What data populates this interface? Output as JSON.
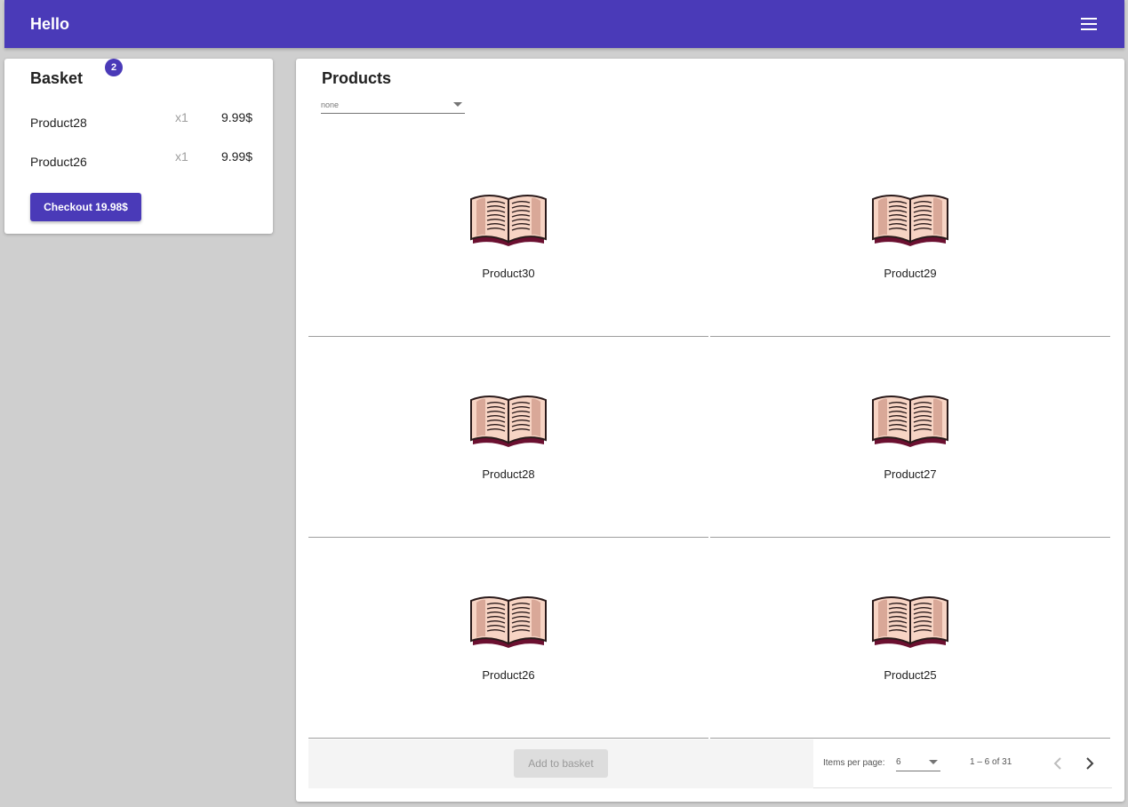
{
  "toolbar": {
    "title": "Hello",
    "menu_icon": "menu-icon"
  },
  "basket": {
    "title": "Basket",
    "badge_count": "2",
    "items": [
      {
        "name": "Product28",
        "qty": "x1",
        "price": "9.99$"
      },
      {
        "name": "Product26",
        "qty": "x1",
        "price": "9.99$"
      }
    ],
    "checkout_label": "Checkout 19.98$"
  },
  "products": {
    "title": "Products",
    "filter": {
      "value": "none"
    },
    "items": [
      {
        "name": "Product30",
        "icon": "open-book-icon"
      },
      {
        "name": "Product29",
        "icon": "open-book-icon"
      },
      {
        "name": "Product28",
        "icon": "open-book-icon"
      },
      {
        "name": "Product27",
        "icon": "open-book-icon"
      },
      {
        "name": "Product26",
        "icon": "open-book-icon"
      },
      {
        "name": "Product25",
        "icon": "open-book-icon"
      }
    ],
    "add_to_basket_label": "Add to basket",
    "paginator": {
      "items_per_page_label": "Items per page:",
      "page_size": "6",
      "range_label": "1 – 6 of 31"
    }
  },
  "colors": {
    "primary": "#4a3ab8",
    "background": "#cfcfcf"
  }
}
